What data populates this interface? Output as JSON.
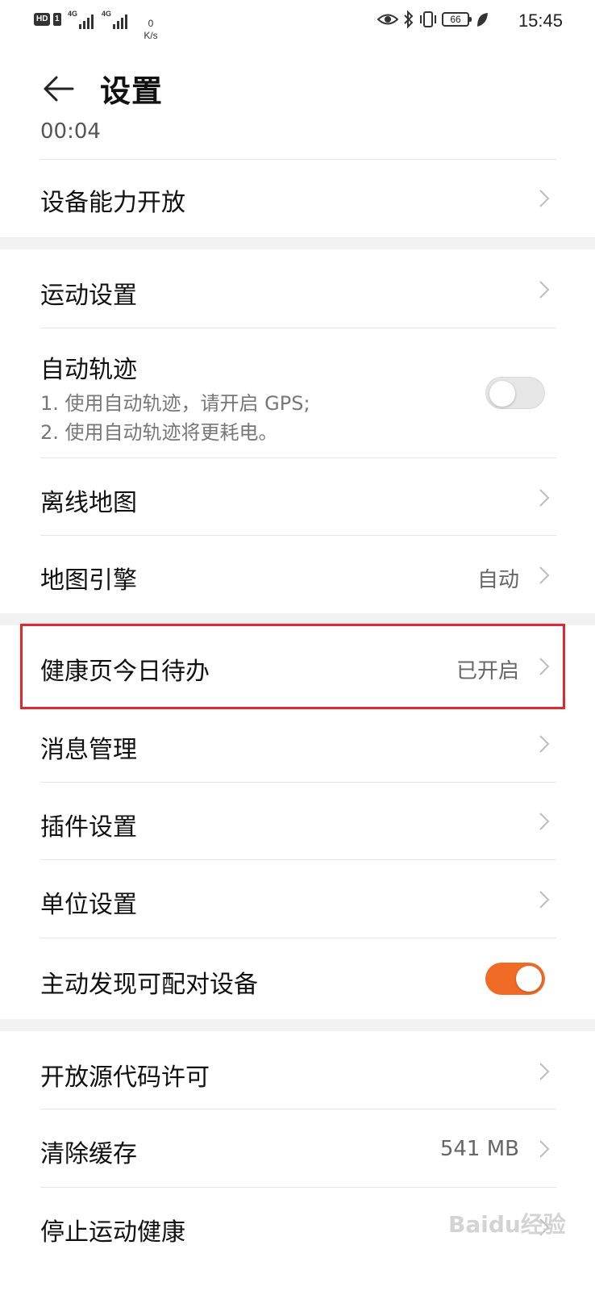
{
  "status_bar": {
    "left_badges": [
      "HD",
      "1"
    ],
    "network_tags": [
      "4G",
      "4G"
    ],
    "speed_value": "0",
    "speed_unit": "K/s",
    "battery": "66",
    "time": "15:45",
    "icons": [
      "eye-icon",
      "bluetooth-icon",
      "vibrate-icon",
      "battery-icon",
      "leaf-icon"
    ]
  },
  "header": {
    "title": "设置",
    "back_icon": "arrow-left-icon"
  },
  "clipped_text": "00:04",
  "rows": {
    "device_capability": {
      "label": "设备能力开放"
    },
    "sport_settings": {
      "label": "运动设置"
    },
    "auto_track": {
      "label": "自动轨迹",
      "desc_line1": "1. 使用自动轨迹，请开启 GPS;",
      "desc_line2": "2. 使用自动轨迹将更耗电。",
      "enabled": false
    },
    "offline_map": {
      "label": "离线地图"
    },
    "map_engine": {
      "label": "地图引擎",
      "value": "自动"
    },
    "health_todo": {
      "label": "健康页今日待办",
      "value": "已开启"
    },
    "message_mgmt": {
      "label": "消息管理"
    },
    "plugin_settings": {
      "label": "插件设置"
    },
    "unit_settings": {
      "label": "单位设置"
    },
    "discover_devices": {
      "label": "主动发现可配对设备",
      "enabled": true
    },
    "open_source": {
      "label": "开放源代码许可"
    },
    "clear_cache": {
      "label": "清除缓存",
      "value": "541 MB"
    },
    "stop_health": {
      "label": "停止运动健康"
    }
  },
  "colors": {
    "toggle_on": "#f06c26",
    "highlight": "#e0282e",
    "section_gap": "#f2f2f2"
  },
  "watermark": "Baidu经验"
}
